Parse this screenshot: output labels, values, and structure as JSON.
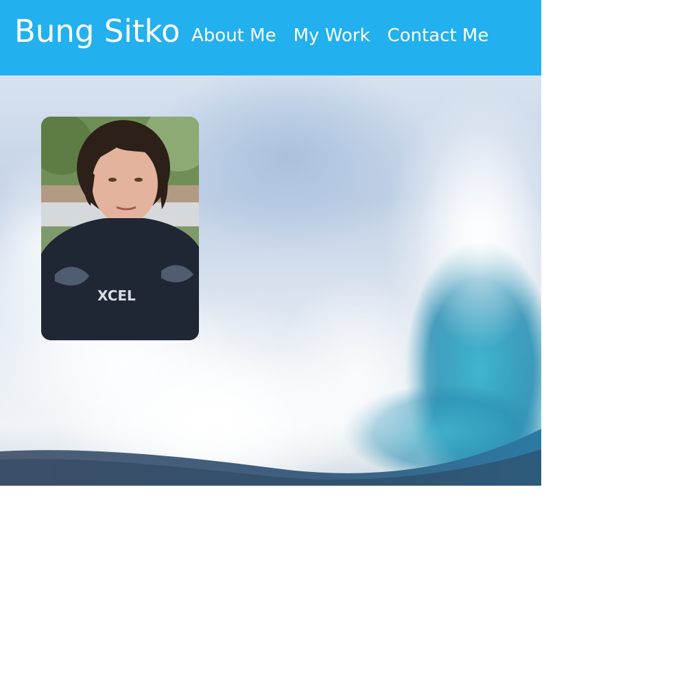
{
  "header": {
    "brand": "Bung Sitko",
    "nav": [
      {
        "label": "About Me"
      },
      {
        "label": "My Work"
      },
      {
        "label": "Contact Me"
      }
    ]
  },
  "hero": {
    "background": "ocean-wave-photo",
    "portrait": {
      "image": "profile-photo",
      "shirt_text": "XCEL"
    }
  },
  "colors": {
    "header_bg": "#23b0ee",
    "header_text": "#ffffff"
  }
}
